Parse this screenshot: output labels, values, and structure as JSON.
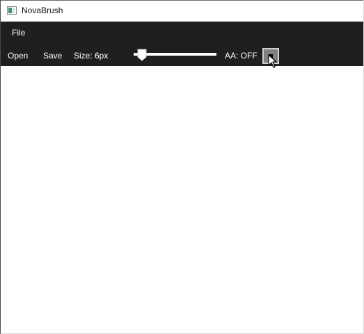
{
  "window": {
    "title": "NovaBrush",
    "app_icon": "app-icon"
  },
  "menu": {
    "items": [
      {
        "label": "File"
      }
    ]
  },
  "toolbar": {
    "open_label": "Open",
    "save_label": "Save",
    "size_label": "Size: 6px",
    "size_slider": {
      "value": 6,
      "fraction": 0.1
    },
    "aa_label": "AA: OFF",
    "color_swatch": {
      "color": "#808080",
      "border": "#d0d0d0"
    }
  },
  "colors": {
    "toolbar_bg": "#1f1f1f",
    "canvas_bg": "#ffffff",
    "text": "#ffffff"
  },
  "cursor": "arrow-cursor-icon"
}
